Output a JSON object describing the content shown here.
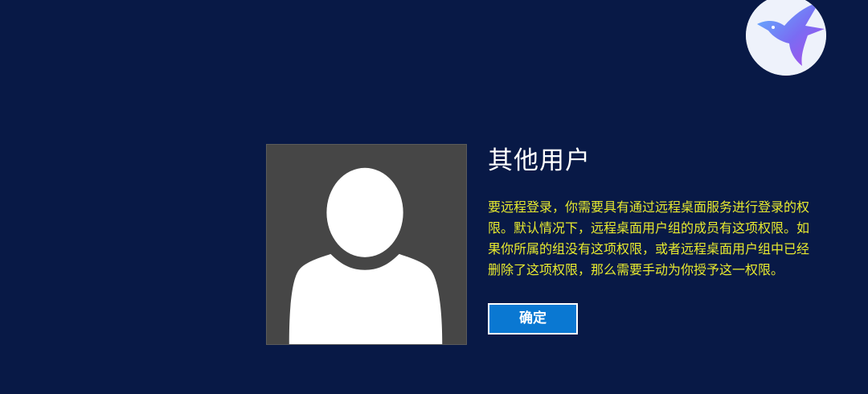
{
  "user": {
    "name": "其他用户"
  },
  "dialog": {
    "message": "要远程登录，你需要具有通过远程桌面服务进行登录的权限。默认情况下，远程桌面用户组的成员有这项权限。如果你所属的组没有这项权限，或者远程桌面用户组中已经删除了这项权限，那么需要手动为你授予这一权限。",
    "ok_label": "确定"
  },
  "icons": {
    "app_logo": "hummingbird-logo-icon",
    "avatar": "default-user-avatar-icon"
  },
  "colors": {
    "background": "#081946",
    "message_text": "#e8ea2f",
    "button": "#0a78d2",
    "avatar_tile": "#464646"
  }
}
